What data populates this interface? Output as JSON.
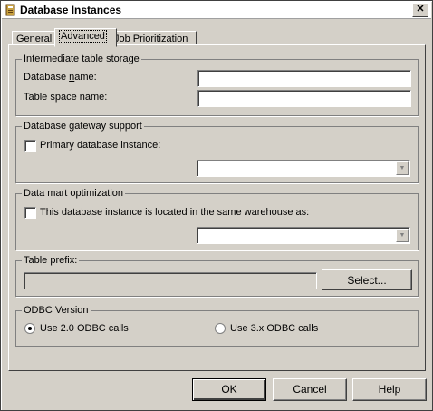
{
  "window": {
    "title": "Database Instances",
    "close_glyph": "✕",
    "app_icon": "database-book-icon"
  },
  "tabs": [
    {
      "label": "General"
    },
    {
      "label": "Advanced"
    },
    {
      "label": "Job Prioritization"
    }
  ],
  "intermediate": {
    "legend": "Intermediate table storage",
    "db_name_label_pre": "Database ",
    "db_name_label_u": "n",
    "db_name_label_post": "ame:",
    "db_name_value": "",
    "table_space_label": "Table space name:",
    "table_space_value": ""
  },
  "gateway": {
    "legend": "Database gateway support",
    "primary_label": "Primary database instance:",
    "primary_checked": false,
    "combo_value": ""
  },
  "datamart": {
    "legend": "Data mart optimization",
    "same_warehouse_label": "This database instance is located in the same warehouse as:",
    "same_warehouse_checked": false,
    "combo_value": ""
  },
  "prefix": {
    "legend": "Table prefix:",
    "value": "",
    "select_button": "Select..."
  },
  "odbc": {
    "legend": "ODBC Version",
    "opt1": "Use 2.0 ODBC calls",
    "opt2": "Use 3.x ODBC calls",
    "selected": "opt1"
  },
  "buttons": {
    "ok": "OK",
    "cancel": "Cancel",
    "help": "Help"
  }
}
